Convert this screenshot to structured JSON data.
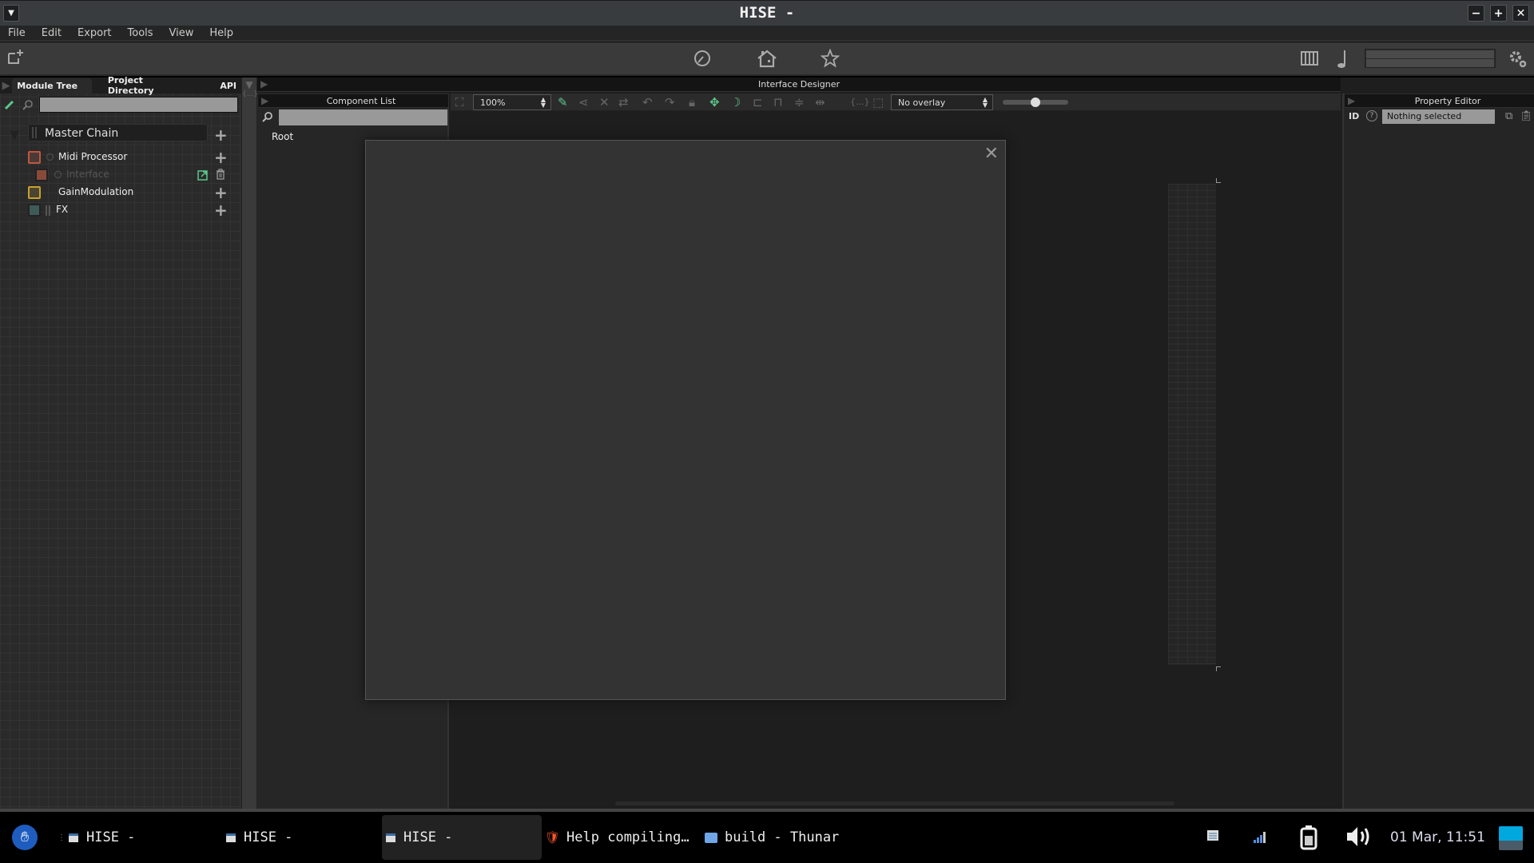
{
  "window": {
    "title": "HISE -"
  },
  "menubar": [
    "File",
    "Edit",
    "Export",
    "Tools",
    "View",
    "Help"
  ],
  "toolbar": {
    "left_icon": "new-window-icon",
    "center_icons": [
      "performance-meter-icon",
      "home-icon",
      "star-icon"
    ],
    "right_icons": [
      "keyboard-icon",
      "midi-note-icon",
      "settings-gear-icon"
    ]
  },
  "left_panel": {
    "tabs": [
      "Module Tree",
      "Project Directory",
      "API"
    ],
    "active_tab": "Module Tree",
    "search": {
      "value": "",
      "placeholder": ""
    },
    "tree": {
      "root": "Master Chain",
      "items": [
        {
          "label": "Midi Processor",
          "color": "#c0563f",
          "level": 1
        },
        {
          "label": "Interface",
          "color": "#a34a38",
          "level": 2,
          "dimmed": true
        },
        {
          "label": "GainModulation",
          "color": "#c9a02f",
          "level": 1
        },
        {
          "label": "FX",
          "color": "#3f6b68",
          "level": 1
        }
      ]
    }
  },
  "center": {
    "header_title": "Interface Designer",
    "component_list": {
      "title": "Component List",
      "search_value": "",
      "root_label": "Root"
    },
    "designer_toolbar": {
      "zoom": "100%",
      "overlay": "No overlay",
      "slider_value": 0.5
    }
  },
  "property_editor": {
    "title": "Property Editor",
    "id_label": "ID",
    "selection": "Nothing selected"
  },
  "taskbar": {
    "apps": [
      {
        "label": "HISE -",
        "active": false
      },
      {
        "label": "HISE -",
        "active": false
      },
      {
        "label": "HISE -",
        "active": true
      },
      {
        "label": "Help compiling…",
        "active": false
      },
      {
        "label": "build - Thunar",
        "active": false
      }
    ],
    "clock": "01 Mar, 11:51"
  },
  "colors": {
    "accent_green": "#5cc88a",
    "background": "#1e1e1e",
    "panel": "#2a2a2a"
  }
}
